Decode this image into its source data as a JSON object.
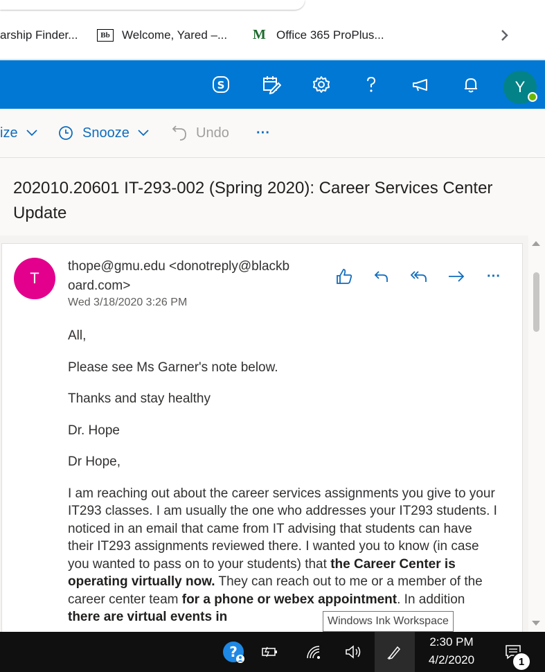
{
  "browser": {
    "bookmarks": [
      {
        "label": "arship Finder..."
      },
      {
        "label": "Welcome, Yared –...",
        "favicon": "Bb"
      },
      {
        "label": "Office 365 ProPlus...",
        "favicon": "M"
      }
    ]
  },
  "header": {
    "icons": [
      "skype-icon",
      "calendar-edit-icon",
      "gear-icon",
      "help-icon",
      "megaphone-icon",
      "bell-icon"
    ],
    "avatar_initial": "Y",
    "brand_color": "#0078d4"
  },
  "commands": {
    "categorize": "ize",
    "snooze": "Snooze",
    "undo": "Undo",
    "more": "···"
  },
  "message": {
    "subject": "202010.20601 IT-293-002 (Spring 2020): Career Services Center Update",
    "avatar_initial": "T",
    "sender": "thope@gmu.edu <donotreply@blackboard.com>",
    "date": "Wed 3/18/2020 3:26 PM",
    "body": {
      "p1": "All,",
      "p2": "Please see Ms Garner's note below.",
      "p3": "Thanks and stay healthy",
      "p4": "Dr. Hope",
      "p5": "Dr Hope,",
      "p6_a": "I am reaching out about the career services assignments you give to your IT293 classes. I am usually the one who addresses your IT293 students. I noticed in an email that came from IT advising that students can have their IT293 assignments reviewed there. I wanted you to know (in case you wanted to pass on to your students) that ",
      "p6_b": "the Career Center is operating virtually now.",
      "p6_c": " They can reach out to me or a member of the career center team ",
      "p6_d": "for a phone or webex appointment",
      "p6_e": ". In addition ",
      "p6_f": "there are virtual events in"
    }
  },
  "tooltip": "Windows Ink Workspace",
  "taskbar": {
    "time": "2:30 PM",
    "date": "4/2/2020",
    "notification_count": "1"
  }
}
